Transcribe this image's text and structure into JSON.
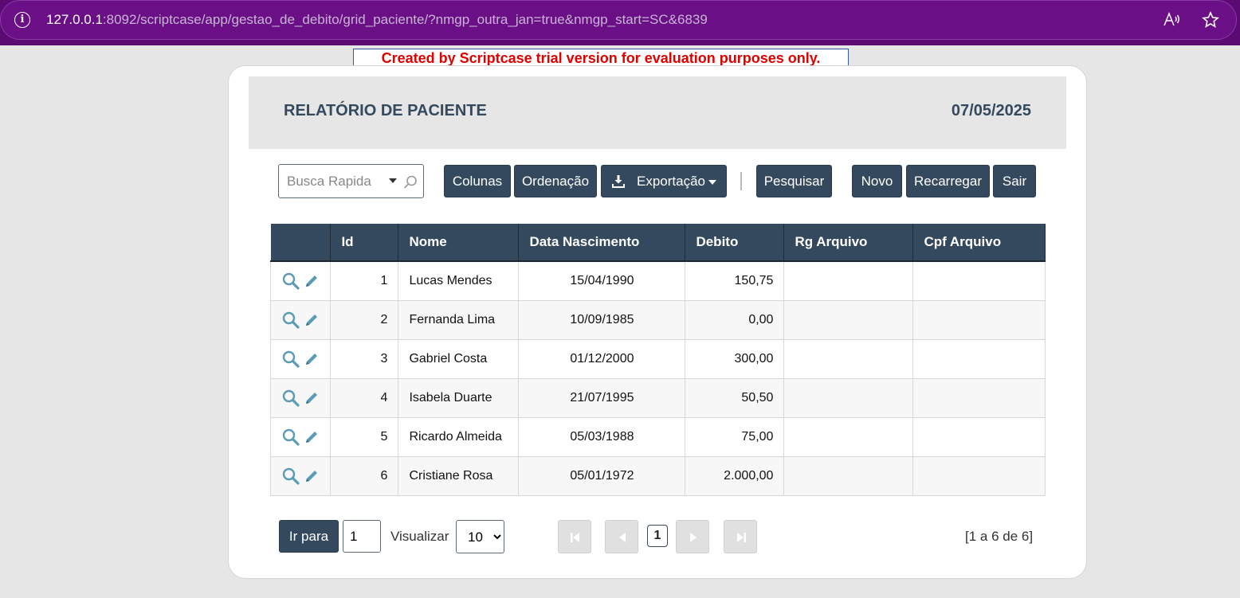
{
  "browser": {
    "url_host": "127.0.0.1",
    "url_rest": ":8092/scriptcase/app/gestao_de_debito/grid_paciente/?nmgp_outra_jan=true&nmgp_start=SC&6839"
  },
  "banner": {
    "text": "Created by Scriptcase trial version for evaluation purposes only."
  },
  "header": {
    "title": "RELATÓRIO DE PACIENTE",
    "date": "07/05/2025"
  },
  "toolbar": {
    "search_placeholder": "Busca Rapida",
    "colunas": "Colunas",
    "ordenacao": "Ordenação",
    "exportacao": "Exportação",
    "pesquisar": "Pesquisar",
    "novo": "Novo",
    "recarregar": "Recarregar",
    "sair": "Sair"
  },
  "table": {
    "columns": [
      "",
      "Id",
      "Nome",
      "Data Nascimento",
      "Debito",
      "Rg Arquivo",
      "Cpf Arquivo"
    ],
    "rows": [
      {
        "id": "1",
        "nome": "Lucas Mendes",
        "data": "15/04/1990",
        "debito": "150,75",
        "rg": "",
        "cpf": ""
      },
      {
        "id": "2",
        "nome": "Fernanda Lima",
        "data": "10/09/1985",
        "debito": "0,00",
        "rg": "",
        "cpf": ""
      },
      {
        "id": "3",
        "nome": "Gabriel Costa",
        "data": "01/12/2000",
        "debito": "300,00",
        "rg": "",
        "cpf": ""
      },
      {
        "id": "4",
        "nome": "Isabela Duarte",
        "data": "21/07/1995",
        "debito": "50,50",
        "rg": "",
        "cpf": ""
      },
      {
        "id": "5",
        "nome": "Ricardo Almeida",
        "data": "05/03/1988",
        "debito": "75,00",
        "rg": "",
        "cpf": ""
      },
      {
        "id": "6",
        "nome": "Cristiane Rosa",
        "data": "05/01/1972",
        "debito": "2.000,00",
        "rg": "",
        "cpf": ""
      }
    ]
  },
  "footer": {
    "ir_para": "Ir para",
    "page_value": "1",
    "visualizar": "Visualizar",
    "per_page": "10",
    "per_page_options": [
      "10"
    ],
    "current_page": "1",
    "record_count": "[1 a 6 de 6]"
  },
  "colors": {
    "primary": "#34495e",
    "browser_bar": "#5b0a73",
    "banner_text": "#e00000"
  },
  "icons": [
    "info-icon",
    "read-aloud-icon",
    "favorite-icon",
    "search-icon",
    "download-icon",
    "magnifier-icon",
    "pencil-icon",
    "first-page-icon",
    "prev-page-icon",
    "next-page-icon",
    "last-page-icon"
  ]
}
